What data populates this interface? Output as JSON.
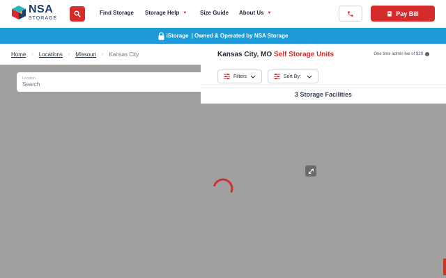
{
  "header": {
    "logo": {
      "name": "NSA",
      "sub": "STORAGE"
    },
    "nav": [
      {
        "label": "Find Storage",
        "dropdown": false
      },
      {
        "label": "Storage Help",
        "dropdown": true
      },
      {
        "label": "Size Guide",
        "dropdown": false
      },
      {
        "label": "About Us",
        "dropdown": true
      }
    ],
    "pay_bill_label": "Pay Bill"
  },
  "banner": {
    "brand": "iStorage",
    "text": "| Owned & Operated by NSA Storage"
  },
  "breadcrumb": {
    "items": [
      "Home",
      "Locations",
      "Missouri"
    ],
    "current": "Kansas City"
  },
  "search": {
    "label": "Location",
    "placeholder": "Search"
  },
  "results": {
    "title_city": "Kansas City, MO",
    "title_accent": "Self Storage Units",
    "fee_text": "One time admin fee of $29",
    "filters_label": "Filters",
    "sort_label": "Sort By:",
    "count_text": "3 Storage Facilities"
  },
  "colors": {
    "accent": "#d62b2b",
    "banner": "#1e9ad6",
    "brand_navy": "#1c3d6b",
    "map_bg": "#a0a0a0"
  },
  "icons": [
    "search-icon",
    "phone-icon",
    "card-icon",
    "lock-icon",
    "sliders-icon",
    "sort-icon",
    "chevron-down-icon",
    "info-icon",
    "expand-icon",
    "loading-spinner"
  ]
}
